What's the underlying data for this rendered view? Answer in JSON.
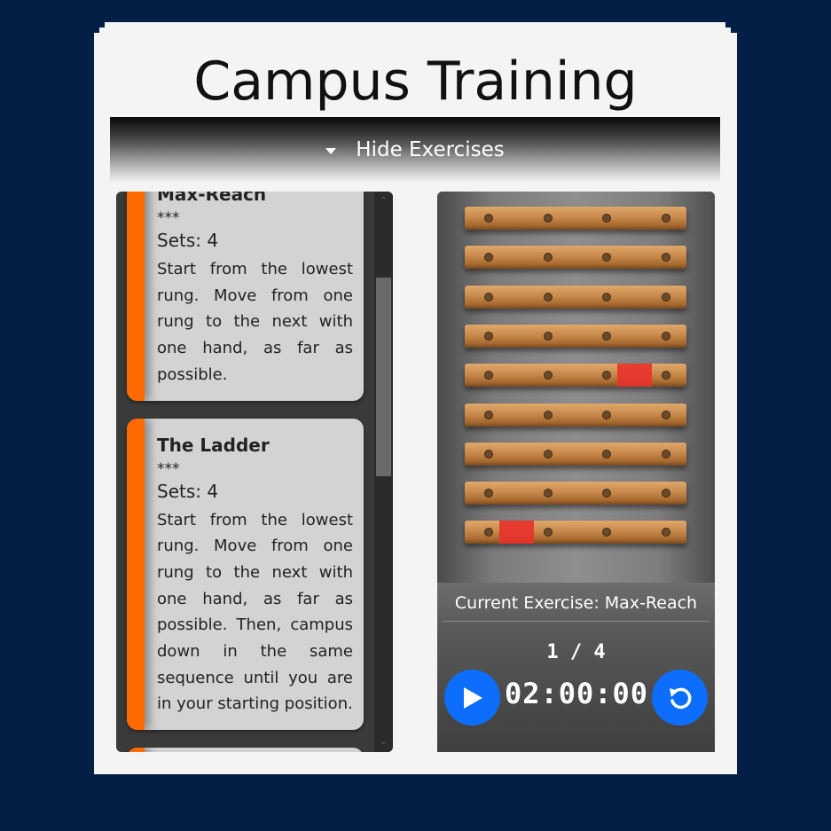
{
  "app": {
    "title": "Campus Training"
  },
  "toggle": {
    "label": "Hide Exercises"
  },
  "exercises": [
    {
      "name": "Max-Reach",
      "rating": "***",
      "sets": "Sets: 4",
      "description": "Start from the lowest rung. Move from one rung to the next with one hand, as far as possible."
    },
    {
      "name": "The Ladder",
      "rating": "***",
      "sets": "Sets: 4",
      "description": "Start from the lowest rung. Move from one rung to the next with one hand, as far as possible. Then, campus down in the same sequence until you are in your starting position."
    }
  ],
  "board": {
    "rung_count": 9,
    "highlighted": [
      {
        "rung": 5,
        "segment": "right"
      },
      {
        "rung": 9,
        "segment": "left"
      }
    ]
  },
  "player": {
    "current_exercise": "Current Exercise: Max-Reach",
    "progress": "1 / 4",
    "timer": "02:00:00",
    "icons": [
      "play-icon",
      "reset-icon"
    ]
  },
  "colors": {
    "background": "#031f45",
    "accent": "#ff6a00",
    "button": "#0d6efd",
    "highlight": "#e8322a"
  }
}
